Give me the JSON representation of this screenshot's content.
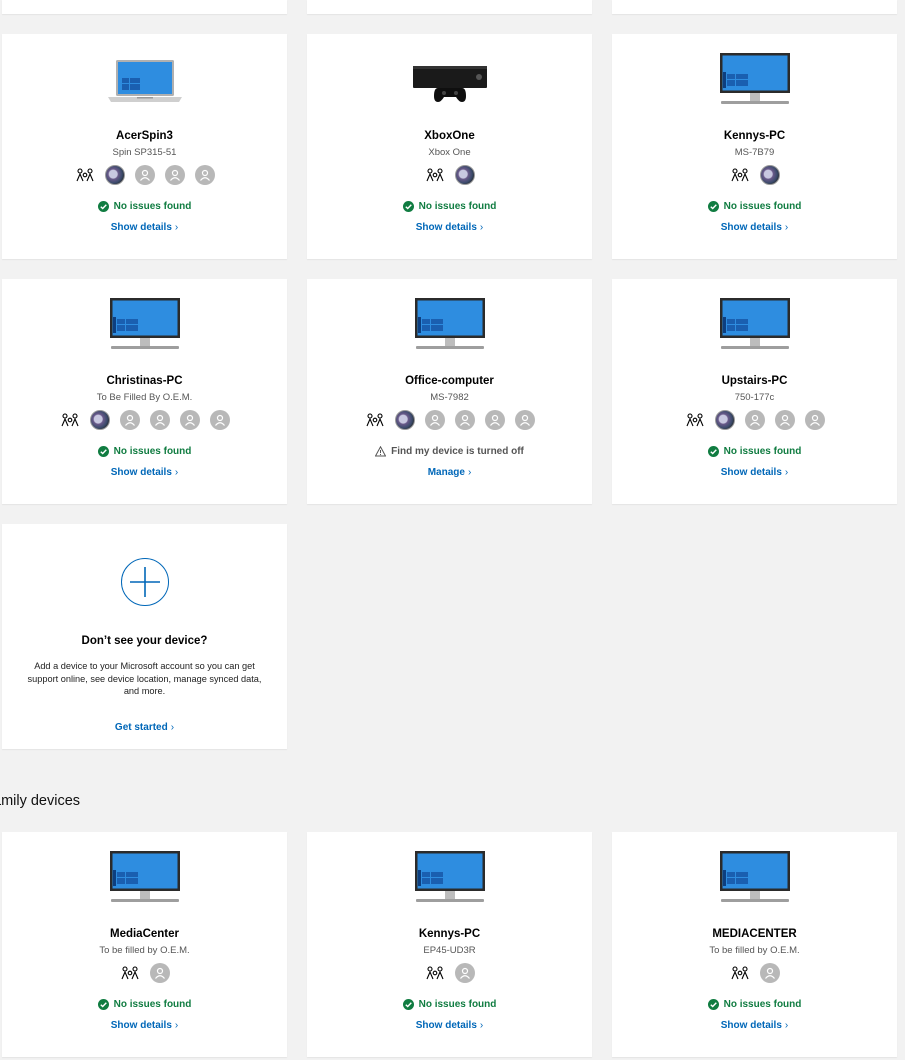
{
  "devices": [
    {
      "name": "AcerSpin3",
      "model": "Spin SP315-51",
      "status": "No issues found",
      "status_type": "ok",
      "link": "Show details",
      "icon": "laptop-icon",
      "users": [
        "photo",
        "empty",
        "empty",
        "empty"
      ]
    },
    {
      "name": "XboxOne",
      "model": "Xbox One",
      "status": "No issues found",
      "status_type": "ok",
      "link": "Show details",
      "icon": "xbox-icon",
      "users": [
        "photo"
      ]
    },
    {
      "name": "Kennys-PC",
      "model": "MS-7B79",
      "status": "No issues found",
      "status_type": "ok",
      "link": "Show details",
      "icon": "desktop-monitor-icon",
      "users": [
        "photo"
      ]
    },
    {
      "name": "Christinas-PC",
      "model": "To Be Filled By O.E.M.",
      "status": "No issues found",
      "status_type": "ok",
      "link": "Show details",
      "icon": "desktop-monitor-icon",
      "users": [
        "photo",
        "empty",
        "empty",
        "empty",
        "empty"
      ]
    },
    {
      "name": "Office-computer",
      "model": "MS-7982",
      "status": "Find my device is turned off",
      "status_type": "warning",
      "link": "Manage",
      "icon": "desktop-monitor-icon",
      "users": [
        "photo",
        "empty",
        "empty",
        "empty",
        "empty"
      ]
    },
    {
      "name": "Upstairs-PC",
      "model": "750-177c",
      "status": "No issues found",
      "status_type": "ok",
      "link": "Show details",
      "icon": "desktop-monitor-icon",
      "users": [
        "photo",
        "empty",
        "empty",
        "empty"
      ]
    }
  ],
  "add_device": {
    "title": "Don’t see your device?",
    "description": "Add a device to your Microsoft account so you can get support online, see device location, manage synced data, and more.",
    "link": "Get started"
  },
  "family_section": {
    "title": "amily devices"
  },
  "family_devices": [
    {
      "name": "MediaCenter",
      "model": "To be filled by O.E.M.",
      "status": "No issues found",
      "status_type": "ok",
      "link": "Show details",
      "icon": "desktop-monitor-icon",
      "users": [
        "empty"
      ]
    },
    {
      "name": "Kennys-PC",
      "model": "EP45-UD3R",
      "status": "No issues found",
      "status_type": "ok",
      "link": "Show details",
      "icon": "desktop-monitor-icon",
      "users": [
        "empty"
      ]
    },
    {
      "name": "MEDIACENTER",
      "model": "To be filled by O.E.M.",
      "status": "No issues found",
      "status_type": "ok",
      "link": "Show details",
      "icon": "desktop-monitor-icon",
      "users": [
        "empty"
      ]
    }
  ],
  "colors": {
    "accent": "#0067b8",
    "ok": "#107c41",
    "background": "#f2f2f2",
    "card": "#ffffff"
  }
}
